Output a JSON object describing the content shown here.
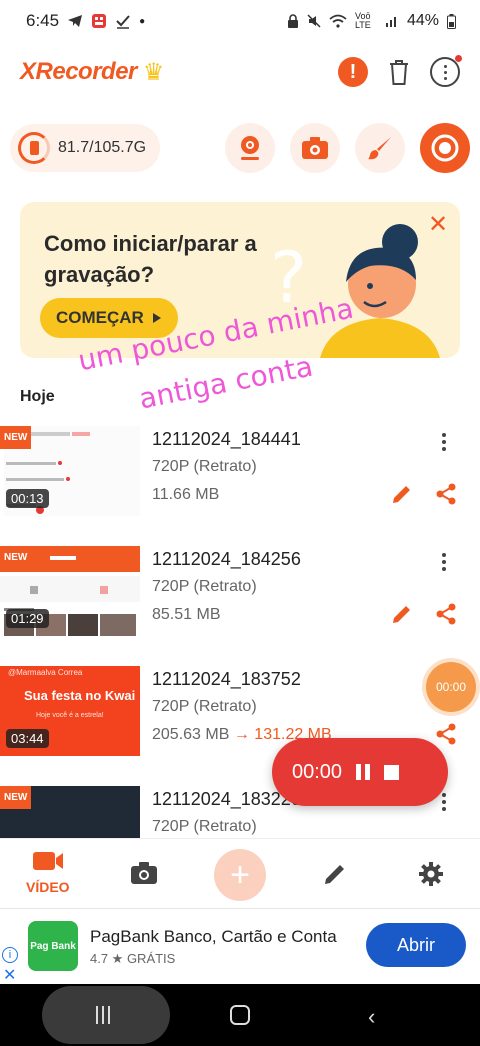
{
  "status_bar": {
    "time": "6:45",
    "network_label": "Voō LTE",
    "battery": "44%"
  },
  "app": {
    "logo": "XRecorder"
  },
  "toolbar": {
    "storage": "81.7/105.7G"
  },
  "banner": {
    "title": "Como iniciar/parar a gravação?",
    "button": "COMEÇAR"
  },
  "watermark": {
    "line1": "um pouco da minha",
    "line2": "antiga conta"
  },
  "list": {
    "section": "Hoje",
    "items": [
      {
        "name": "12112024_184441",
        "resolution": "720P (Retrato)",
        "size": "11.66 MB",
        "duration": "00:13",
        "is_new": true,
        "new_label": "NEW"
      },
      {
        "name": "12112024_184256",
        "resolution": "720P (Retrato)",
        "size": "85.51 MB",
        "duration": "01:29",
        "is_new": true,
        "new_label": "NEW"
      },
      {
        "name": "12112024_183752",
        "resolution": "720P (Retrato)",
        "size": "205.63 MB",
        "compressed_size": "131.22 MB",
        "duration": "03:44",
        "is_new": false,
        "thumb_text": [
          "@Marmaalva Correa",
          "Sua festa no Kwai",
          "Hoje você é a estrela!"
        ]
      },
      {
        "name": "12112024_183220",
        "resolution": "720P (Retrato)",
        "is_new": true,
        "new_label": "NEW"
      }
    ]
  },
  "floating_timer": "00:00",
  "recording_panel": {
    "time": "00:00"
  },
  "bottom_nav": {
    "video_label": "VÍDEO"
  },
  "ad": {
    "app_name": "PagBank Banco, Cartão e Conta",
    "logo_text": "Pag Bank",
    "rating": "4.7 ★  GRÁTIS",
    "install": "Abrir"
  },
  "colors": {
    "accent": "#f05a22",
    "banner_bg": "#fdf2d4",
    "record_red": "#e53935",
    "ad_button": "#1a5ac8",
    "watermark": "#ee58d8"
  }
}
